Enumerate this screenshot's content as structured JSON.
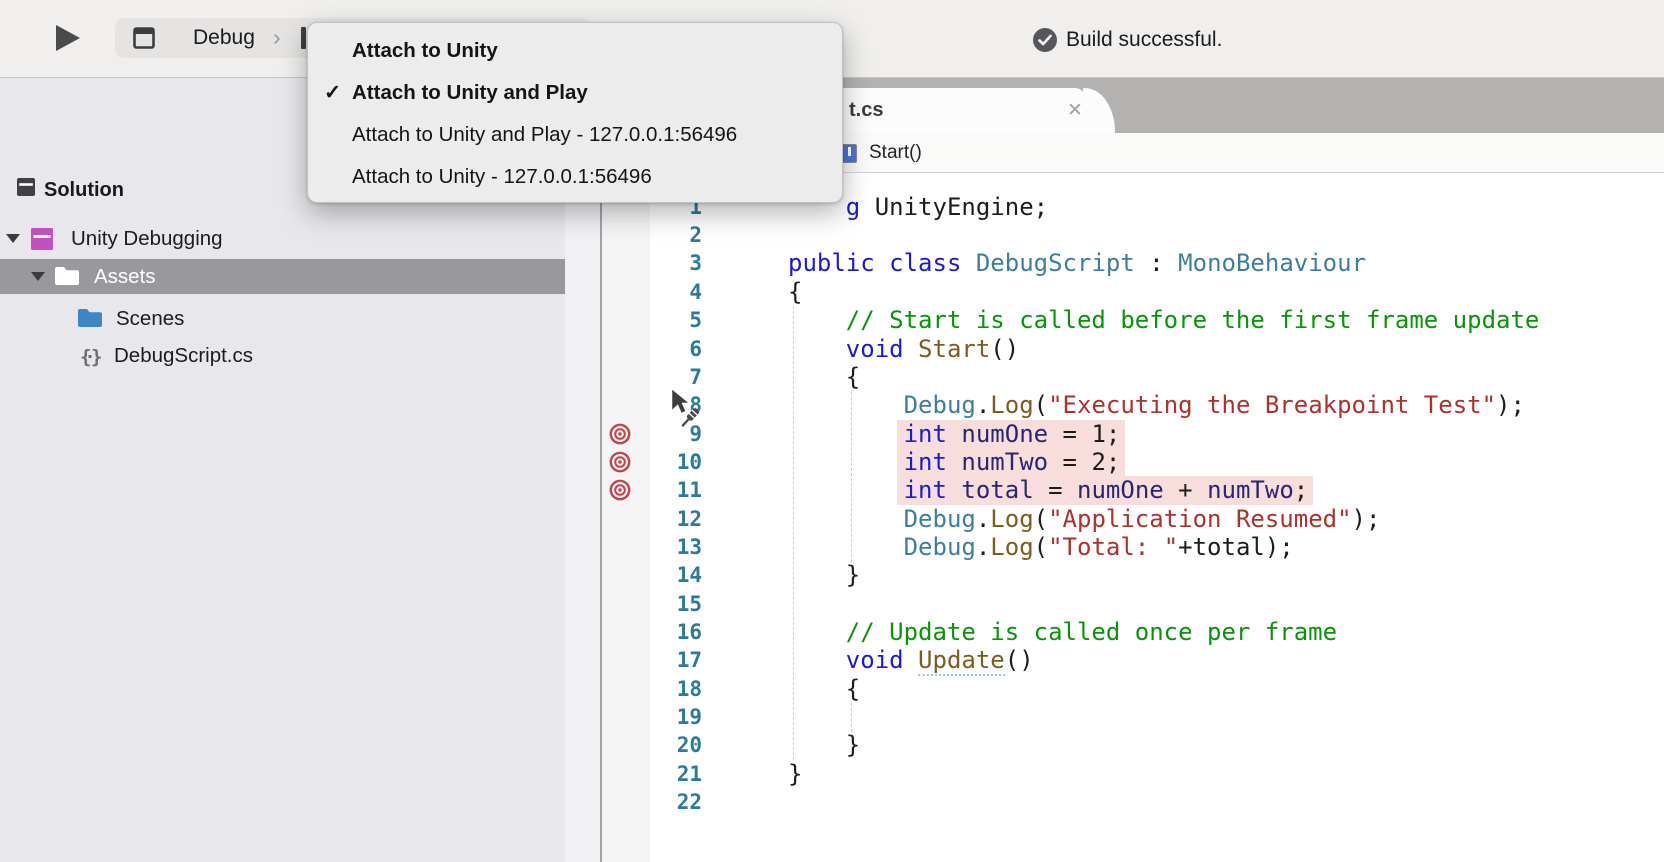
{
  "toolbar": {
    "config_label": "Debug",
    "config_chevron": "›",
    "status_text": "Build successful."
  },
  "menu": {
    "items": [
      {
        "label": "Attach to Unity",
        "bold": true,
        "checked": false
      },
      {
        "label": "Attach to Unity and Play",
        "bold": true,
        "checked": true
      },
      {
        "label": "Attach to Unity and Play - 127.0.0.1:56496",
        "bold": false,
        "checked": false
      },
      {
        "label": "Attach to Unity - 127.0.0.1:56496",
        "bold": false,
        "checked": false
      }
    ],
    "check_glyph": "✓"
  },
  "sidebar": {
    "header": "Solution",
    "tree": [
      {
        "label": "Unity Debugging",
        "icon": "project",
        "expanded": true,
        "selected": false
      },
      {
        "label": "Assets",
        "icon": "folder-white",
        "expanded": true,
        "selected": true
      },
      {
        "label": "Scenes",
        "icon": "folder-blue",
        "expanded": false,
        "selected": false
      },
      {
        "label": "DebugScript.cs",
        "icon": "csharp-file",
        "expanded": false,
        "selected": false
      }
    ]
  },
  "editor": {
    "tab": {
      "title": "t.cs",
      "close_glyph": "✕"
    },
    "breadcrumb": "Start()",
    "breakpoint_lines": [
      9,
      10,
      11
    ],
    "highlighted_lines": [
      9,
      10,
      11
    ],
    "lines": [
      {
        "n": 1,
        "s": [
          [
            "pl",
            "    "
          ],
          [
            "kw",
            "g"
          ],
          [
            "pl",
            " UnityEngine;"
          ]
        ]
      },
      {
        "n": 2,
        "s": []
      },
      {
        "n": 3,
        "s": [
          [
            "kw",
            "public"
          ],
          [
            "pl",
            " "
          ],
          [
            "kw",
            "class"
          ],
          [
            "pl",
            " "
          ],
          [
            "ty",
            "DebugScript"
          ],
          [
            "pl",
            " : "
          ],
          [
            "ty",
            "MonoBehaviour"
          ]
        ]
      },
      {
        "n": 4,
        "s": [
          [
            "pl",
            "{"
          ]
        ]
      },
      {
        "n": 5,
        "s": [
          [
            "pl",
            "    "
          ],
          [
            "cm",
            "// Start is called before the first frame update"
          ]
        ]
      },
      {
        "n": 6,
        "s": [
          [
            "pl",
            "    "
          ],
          [
            "kw",
            "void"
          ],
          [
            "pl",
            " "
          ],
          [
            "me",
            "Start"
          ],
          [
            "pl",
            "()"
          ]
        ]
      },
      {
        "n": 7,
        "s": [
          [
            "pl",
            "    {"
          ]
        ]
      },
      {
        "n": 8,
        "s": [
          [
            "pl",
            "        "
          ],
          [
            "ty",
            "Debug"
          ],
          [
            "pl",
            "."
          ],
          [
            "me",
            "Log"
          ],
          [
            "pl",
            "("
          ],
          [
            "st",
            "\"Executing the Breakpoint Test\""
          ],
          [
            "pl",
            ");"
          ]
        ]
      },
      {
        "n": 9,
        "s": [
          [
            "pl",
            "        "
          ],
          [
            "kw",
            "int"
          ],
          [
            "pl",
            " "
          ],
          [
            "va",
            "numOne"
          ],
          [
            "pl",
            " = 1;"
          ]
        ]
      },
      {
        "n": 10,
        "s": [
          [
            "pl",
            "        "
          ],
          [
            "kw",
            "int"
          ],
          [
            "pl",
            " "
          ],
          [
            "va",
            "numTwo"
          ],
          [
            "pl",
            " = 2;"
          ]
        ]
      },
      {
        "n": 11,
        "s": [
          [
            "pl",
            "        "
          ],
          [
            "kw",
            "int"
          ],
          [
            "pl",
            " "
          ],
          [
            "va",
            "total"
          ],
          [
            "pl",
            " = "
          ],
          [
            "va",
            "numOne"
          ],
          [
            "pl",
            " + "
          ],
          [
            "va",
            "numTwo"
          ],
          [
            "pl",
            ";"
          ]
        ]
      },
      {
        "n": 12,
        "s": [
          [
            "pl",
            "        "
          ],
          [
            "ty",
            "Debug"
          ],
          [
            "pl",
            "."
          ],
          [
            "me",
            "Log"
          ],
          [
            "pl",
            "("
          ],
          [
            "st",
            "\"Application Resumed\""
          ],
          [
            "pl",
            ");"
          ]
        ]
      },
      {
        "n": 13,
        "s": [
          [
            "pl",
            "        "
          ],
          [
            "ty",
            "Debug"
          ],
          [
            "pl",
            "."
          ],
          [
            "me",
            "Log"
          ],
          [
            "pl",
            "("
          ],
          [
            "st",
            "\"Total: \""
          ],
          [
            "pl",
            "+total);"
          ]
        ]
      },
      {
        "n": 14,
        "s": [
          [
            "pl",
            "    }"
          ]
        ]
      },
      {
        "n": 15,
        "s": []
      },
      {
        "n": 16,
        "s": [
          [
            "pl",
            "    "
          ],
          [
            "cm",
            "// Update is called once per frame"
          ]
        ]
      },
      {
        "n": 17,
        "s": [
          [
            "pl",
            "    "
          ],
          [
            "kw",
            "void"
          ],
          [
            "pl",
            " "
          ],
          [
            "me",
            "Update",
            "u"
          ],
          [
            "pl",
            "()"
          ]
        ]
      },
      {
        "n": 18,
        "s": [
          [
            "pl",
            "    {"
          ]
        ]
      },
      {
        "n": 19,
        "s": []
      },
      {
        "n": 20,
        "s": [
          [
            "pl",
            "    }"
          ]
        ]
      },
      {
        "n": 21,
        "s": [
          [
            "pl",
            "}"
          ]
        ]
      },
      {
        "n": 22,
        "s": []
      }
    ]
  },
  "colors": {
    "tokens": {
      "kw": "#1c18dd",
      "ty": "#3d7f9d",
      "me": "#7d5d1f",
      "cm": "#089608",
      "st": "#b0302c",
      "va": "#2a2570",
      "pl": "#1d1d1d"
    },
    "line_number": "#2c7a9d",
    "breakpoint": "#c8424e",
    "line_highlight": "#f7dedd",
    "selected_row": "#98989d",
    "folder_blue": "#3e86c4",
    "project_magenta": "#c44fc2",
    "tab_strip": "#b4b2b1",
    "sidebar_bg": "#e8e8ec"
  }
}
